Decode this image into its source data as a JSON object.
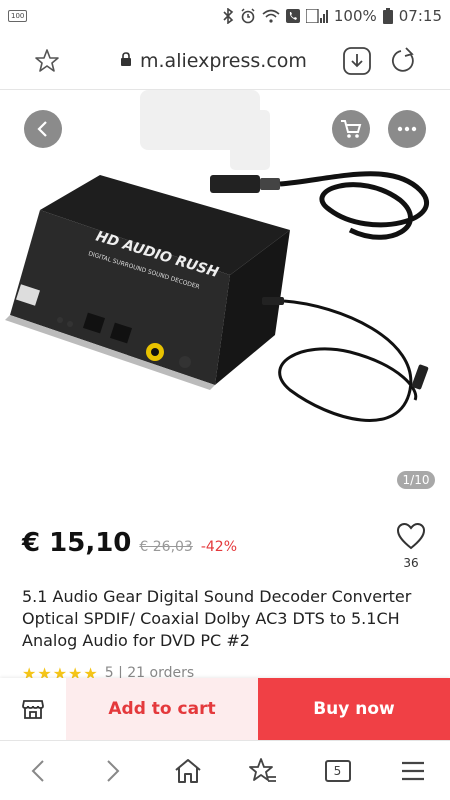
{
  "status": {
    "left_badge": "100",
    "battery_text": "100%",
    "time": "07:15"
  },
  "browser": {
    "url": "m.aliexpress.com",
    "tabs_count": "5"
  },
  "gallery": {
    "counter": "1/10",
    "headline_text": "HD AUDIO RUSH",
    "subline_text": "DIGITAL SURROUND SOUND DECODER"
  },
  "product": {
    "price": "€ 15,10",
    "old_price": "€ 26,03",
    "discount": "-42%",
    "wishlist_count": "36",
    "title": "5.1 Audio Gear Digital Sound Decoder Converter Optical SPDIF/ Coaxial Dolby AC3 DTS to 5.1CH Analog Audio for DVD PC #2",
    "rating_stars": "★★★★★",
    "rating_text": "5 | 21 orders"
  },
  "actions": {
    "add_to_cart": "Add to cart",
    "buy_now": "Buy now"
  },
  "colors": {
    "accent": "#f04045",
    "accent_light": "#fdeced",
    "star": "#f5c518"
  }
}
